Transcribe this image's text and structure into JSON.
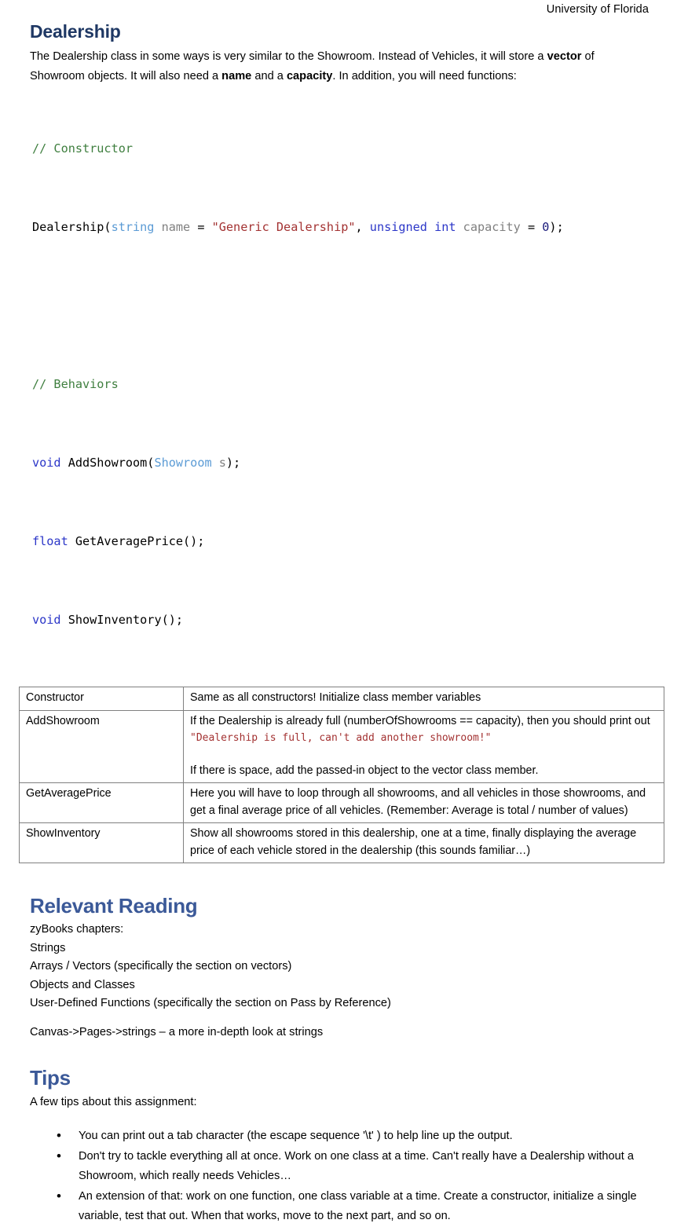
{
  "header": {
    "institution": "University of Florida"
  },
  "dealership": {
    "heading": "Dealership",
    "intro_1": "The Dealership class in some ways is very similar to the Showroom. Instead of Vehicles, it will store a ",
    "intro_bold_1": "vector",
    "intro_2": " of Showroom objects. It will also need a ",
    "intro_bold_2": "name",
    "intro_3": " and a ",
    "intro_bold_3": "capacity",
    "intro_4": ". In addition, you will need functions:"
  },
  "code": {
    "comment_constructor": "// Constructor",
    "ctor_fn": "Dealership(",
    "ctor_type_string": "string",
    "ctor_param_name": " name",
    "ctor_eq1": " = ",
    "ctor_default_name": "\"Generic Dealership\"",
    "ctor_comma": ", ",
    "ctor_type_unsigned": "unsigned int",
    "ctor_param_capacity": " capacity",
    "ctor_eq2": " = ",
    "ctor_default_capacity": "0",
    "ctor_close": ");",
    "comment_behaviors": "// Behaviors",
    "b1_type": "void",
    "b1_name": " AddShowroom(",
    "b1_class": "Showroom",
    "b1_arg": " s",
    "b1_close": ");",
    "b2_type": "float",
    "b2_name": " GetAveragePrice();",
    "b3_type": "void",
    "b3_name": " ShowInventory();"
  },
  "spec_table": {
    "rows": [
      {
        "name": "Constructor",
        "desc_1": "Same as all constructors! Initialize class member variables",
        "mono": "",
        "desc_2": ""
      },
      {
        "name": "AddShowroom",
        "desc_1": "If the Dealership is already full (numberOfShowrooms == capacity), then you should print out ",
        "mono": "\"Dealership is full, can't add another showroom!\"",
        "desc_2": "If there is space, add the passed-in object to the vector class member."
      },
      {
        "name": "GetAveragePrice",
        "desc_1": "Here you will have to loop through all showrooms, and all vehicles in those showrooms, and get a final average price of all vehicles. (Remember: Average is total / number of values)",
        "mono": "",
        "desc_2": ""
      },
      {
        "name": "ShowInventory",
        "desc_1": "Show all showrooms stored in this dealership, one at a time, finally displaying the average price of each vehicle stored in the dealership (this sounds familiar…)",
        "mono": "",
        "desc_2": ""
      }
    ]
  },
  "reading": {
    "heading": "Relevant Reading",
    "lines": [
      "zyBooks chapters:",
      "Strings",
      "Arrays / Vectors (specifically the section on vectors)",
      "Objects and Classes",
      "User-Defined Functions (specifically the section on Pass by Reference)"
    ],
    "extra_line": "Canvas->Pages->strings – a more in-depth look at strings"
  },
  "tips": {
    "heading": "Tips",
    "intro": "A few tips about this assignment:",
    "bullet_char": "•",
    "items": [
      "You can print out a tab character (the escape sequence '\\t' ) to help line up the output.",
      "Don't try to tackle everything all at once. Work on one class at a time. Can't really have a Dealership without a Showroom, which really needs Vehicles…",
      "An extension of that: work on one function, one class variable at a time. Create a constructor, initialize a single variable, test that out. When that works, move to the next part, and so on."
    ]
  },
  "colors": {
    "heading_dark": "#1F3864",
    "heading_blue": "#3B5998",
    "code_comment": "#3F7F3F",
    "code_type": "#2B36C8",
    "code_class": "#5B9BD5",
    "code_var": "#808080",
    "code_string": "#A33232",
    "table_border": "#808080"
  }
}
